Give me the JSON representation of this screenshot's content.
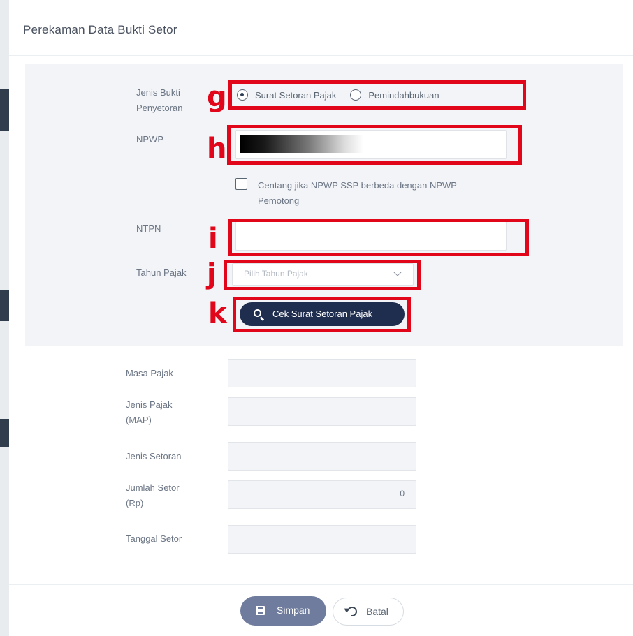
{
  "modal": {
    "title": "Perekaman Data Bukti Setor"
  },
  "search_panel": {
    "jenis_bukti_label_line1": "Jenis Bukti",
    "jenis_bukti_label_line2": "Penyetoran",
    "radio_options": [
      {
        "label": "Surat Setoran Pajak",
        "selected": true
      },
      {
        "label": "Pemindahbukuan",
        "selected": false
      }
    ],
    "npwp_label": "NPWP",
    "npwp_value_redacted": true,
    "checkbox_label_line1": "Centang jika NPWP SSP berbeda dengan NPWP",
    "checkbox_label_line2": "Pemotong",
    "checkbox_checked": false,
    "ntpn_label": "NTPN",
    "ntpn_value": "",
    "tahun_pajak_label": "Tahun Pajak",
    "tahun_pajak_placeholder": "Pilih Tahun Pajak",
    "cek_button_label": "Cek Surat Setoran Pajak"
  },
  "details": {
    "masa_pajak_label": "Masa Pajak",
    "jenis_pajak_label_line1": "Jenis Pajak",
    "jenis_pajak_label_line2": "(MAP)",
    "jenis_setoran_label": "Jenis Setoran",
    "jumlah_setor_label_line1": "Jumlah Setor",
    "jumlah_setor_label_line2": "(Rp)",
    "jumlah_setor_value": "0",
    "tanggal_setor_label": "Tanggal Setor"
  },
  "footer": {
    "simpan_label": "Simpan",
    "batal_label": "Batal"
  },
  "annotations": {
    "g": "g",
    "h": "h",
    "i": "i",
    "j": "j",
    "k": "k"
  },
  "colors": {
    "annotation_red": "#e1061a",
    "primary_button": "#1f2d4e",
    "save_button": "#6f7c9d",
    "panel_bg": "#f2f4f7"
  },
  "icons": {
    "cek_button": "search-icon",
    "simpan_button": "floppy-disk-icon",
    "batal_button": "undo-icon",
    "tahun_select": "chevron-down-icon"
  }
}
